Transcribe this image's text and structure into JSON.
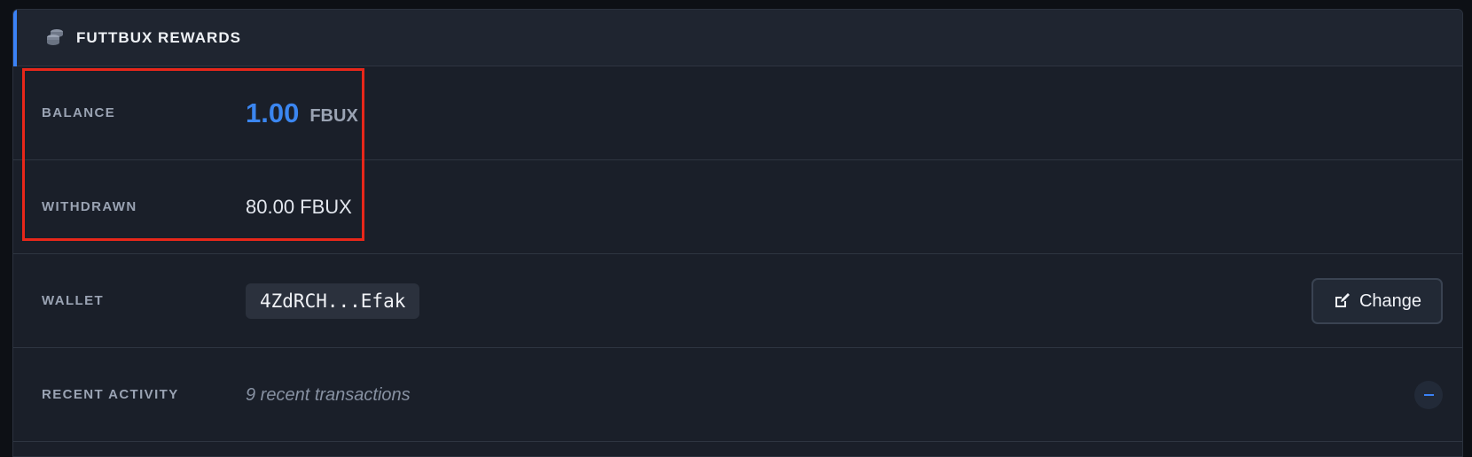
{
  "panel": {
    "title": "FUTTBUX REWARDS",
    "icon": "coins-icon",
    "accent_color": "#3b82f6"
  },
  "rows": {
    "balance": {
      "label": "BALANCE",
      "amount": "1.00",
      "unit": "FBUX"
    },
    "withdrawn": {
      "label": "WITHDRAWN",
      "value": "80.00 FBUX"
    },
    "wallet": {
      "label": "WALLET",
      "address": "4ZdRCH...Efak",
      "button_label": "Change",
      "button_icon": "edit-icon"
    },
    "activity": {
      "label": "RECENT ACTIVITY",
      "summary": "9 recent transactions",
      "toggle_icon": "minus-icon"
    }
  },
  "annotation": {
    "highlight_color": "#e8271a"
  }
}
